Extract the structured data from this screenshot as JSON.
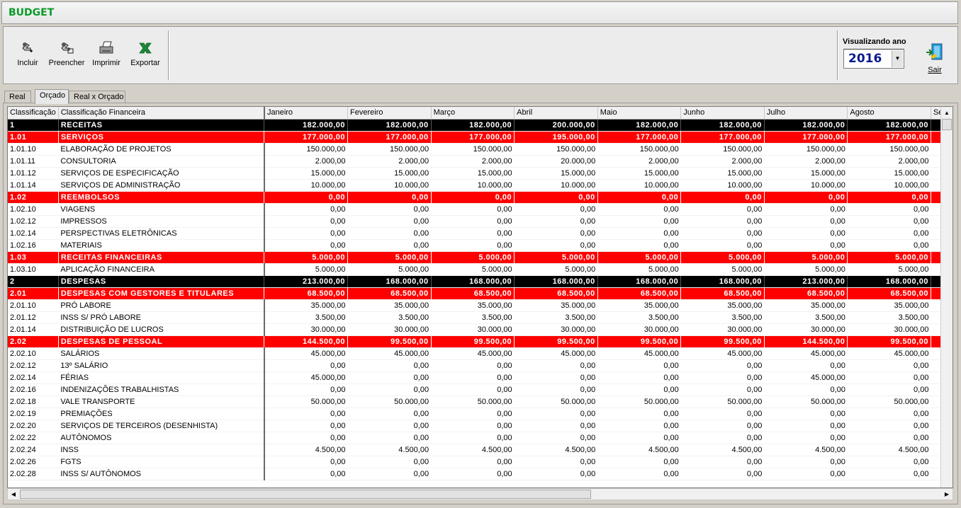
{
  "app": {
    "title": "BUDGET"
  },
  "toolbar": {
    "incluir": "Incluir",
    "preencher": "Preencher",
    "imprimir": "Imprimir",
    "exportar": "Exportar",
    "year_label": "Visualizando ano",
    "year_value": "2016",
    "exit_label": "Sair"
  },
  "tabs": [
    "Real",
    "Orçado",
    "Real x Orçado"
  ],
  "active_tab": "Orçado",
  "colors": {
    "section_black": "#000000",
    "section_red": "#ff0000",
    "title_green": "#0a9a2a",
    "year_blue": "#0a1a8c"
  },
  "grid": {
    "columns": [
      "Classificação",
      "Classificação Financeira",
      "Janeiro",
      "Fevereiro",
      "Março",
      "Abril",
      "Maio",
      "Junho",
      "Julho",
      "Agosto",
      "Se"
    ],
    "rows": [
      {
        "level": "black",
        "code": "1",
        "name": "RECEITAS",
        "values": [
          "182.000,00",
          "182.000,00",
          "182.000,00",
          "200.000,00",
          "182.000,00",
          "182.000,00",
          "182.000,00",
          "182.000,00"
        ]
      },
      {
        "level": "red",
        "code": "1.01",
        "name": "SERVIÇOS",
        "values": [
          "177.000,00",
          "177.000,00",
          "177.000,00",
          "195.000,00",
          "177.000,00",
          "177.000,00",
          "177.000,00",
          "177.000,00"
        ]
      },
      {
        "level": "normal",
        "code": "1.01.10",
        "name": "ELABORAÇÃO DE PROJETOS",
        "values": [
          "150.000,00",
          "150.000,00",
          "150.000,00",
          "150.000,00",
          "150.000,00",
          "150.000,00",
          "150.000,00",
          "150.000,00"
        ]
      },
      {
        "level": "normal",
        "code": "1.01.11",
        "name": "CONSULTORIA",
        "values": [
          "2.000,00",
          "2.000,00",
          "2.000,00",
          "20.000,00",
          "2.000,00",
          "2.000,00",
          "2.000,00",
          "2.000,00"
        ]
      },
      {
        "level": "normal",
        "code": "1.01.12",
        "name": "SERVIÇOS DE ESPECIFICAÇÃO",
        "values": [
          "15.000,00",
          "15.000,00",
          "15.000,00",
          "15.000,00",
          "15.000,00",
          "15.000,00",
          "15.000,00",
          "15.000,00"
        ]
      },
      {
        "level": "normal",
        "code": "1.01.14",
        "name": "SERVIÇOS DE ADMINISTRAÇÃO",
        "values": [
          "10.000,00",
          "10.000,00",
          "10.000,00",
          "10.000,00",
          "10.000,00",
          "10.000,00",
          "10.000,00",
          "10.000,00"
        ]
      },
      {
        "level": "red",
        "code": "1.02",
        "name": "REEMBOLSOS",
        "values": [
          "0,00",
          "0,00",
          "0,00",
          "0,00",
          "0,00",
          "0,00",
          "0,00",
          "0,00"
        ]
      },
      {
        "level": "normal",
        "code": "1.02.10",
        "name": "VIAGENS",
        "values": [
          "0,00",
          "0,00",
          "0,00",
          "0,00",
          "0,00",
          "0,00",
          "0,00",
          "0,00"
        ]
      },
      {
        "level": "normal",
        "code": "1.02.12",
        "name": "IMPRESSOS",
        "values": [
          "0,00",
          "0,00",
          "0,00",
          "0,00",
          "0,00",
          "0,00",
          "0,00",
          "0,00"
        ]
      },
      {
        "level": "normal",
        "code": "1.02.14",
        "name": "PERSPECTIVAS ELETRÔNICAS",
        "values": [
          "0,00",
          "0,00",
          "0,00",
          "0,00",
          "0,00",
          "0,00",
          "0,00",
          "0,00"
        ]
      },
      {
        "level": "normal",
        "code": "1.02.16",
        "name": "MATERIAIS",
        "values": [
          "0,00",
          "0,00",
          "0,00",
          "0,00",
          "0,00",
          "0,00",
          "0,00",
          "0,00"
        ]
      },
      {
        "level": "red",
        "code": "1.03",
        "name": "RECEITAS FINANCEIRAS",
        "values": [
          "5.000,00",
          "5.000,00",
          "5.000,00",
          "5.000,00",
          "5.000,00",
          "5.000,00",
          "5.000,00",
          "5.000,00"
        ]
      },
      {
        "level": "normal",
        "code": "1.03.10",
        "name": "APLICAÇÃO FINANCEIRA",
        "values": [
          "5.000,00",
          "5.000,00",
          "5.000,00",
          "5.000,00",
          "5.000,00",
          "5.000,00",
          "5.000,00",
          "5.000,00"
        ]
      },
      {
        "level": "black",
        "code": "2",
        "name": "DESPESAS",
        "values": [
          "213.000,00",
          "168.000,00",
          "168.000,00",
          "168.000,00",
          "168.000,00",
          "168.000,00",
          "213.000,00",
          "168.000,00"
        ]
      },
      {
        "level": "red",
        "code": "2.01",
        "name": "DESPESAS COM GESTORES E TITULARES",
        "values": [
          "68.500,00",
          "68.500,00",
          "68.500,00",
          "68.500,00",
          "68.500,00",
          "68.500,00",
          "68.500,00",
          "68.500,00"
        ]
      },
      {
        "level": "normal",
        "code": "2.01.10",
        "name": "PRÓ LABORE",
        "values": [
          "35.000,00",
          "35.000,00",
          "35.000,00",
          "35.000,00",
          "35.000,00",
          "35.000,00",
          "35.000,00",
          "35.000,00"
        ]
      },
      {
        "level": "normal",
        "code": "2.01.12",
        "name": "INSS S/ PRÓ LABORE",
        "values": [
          "3.500,00",
          "3.500,00",
          "3.500,00",
          "3.500,00",
          "3.500,00",
          "3.500,00",
          "3.500,00",
          "3.500,00"
        ]
      },
      {
        "level": "normal",
        "code": "2.01.14",
        "name": "DISTRIBUIÇÃO DE LUCROS",
        "values": [
          "30.000,00",
          "30.000,00",
          "30.000,00",
          "30.000,00",
          "30.000,00",
          "30.000,00",
          "30.000,00",
          "30.000,00"
        ]
      },
      {
        "level": "red",
        "code": "2.02",
        "name": "DESPESAS DE PESSOAL",
        "values": [
          "144.500,00",
          "99.500,00",
          "99.500,00",
          "99.500,00",
          "99.500,00",
          "99.500,00",
          "144.500,00",
          "99.500,00"
        ]
      },
      {
        "level": "normal",
        "code": "2.02.10",
        "name": "SALÁRIOS",
        "values": [
          "45.000,00",
          "45.000,00",
          "45.000,00",
          "45.000,00",
          "45.000,00",
          "45.000,00",
          "45.000,00",
          "45.000,00"
        ]
      },
      {
        "level": "normal",
        "code": "2.02.12",
        "name": "13º SALÁRIO",
        "values": [
          "0,00",
          "0,00",
          "0,00",
          "0,00",
          "0,00",
          "0,00",
          "0,00",
          "0,00"
        ]
      },
      {
        "level": "normal",
        "code": "2.02.14",
        "name": "FÉRIAS",
        "values": [
          "45.000,00",
          "0,00",
          "0,00",
          "0,00",
          "0,00",
          "0,00",
          "45.000,00",
          "0,00"
        ]
      },
      {
        "level": "normal",
        "code": "2.02.16",
        "name": "INDENIZAÇÕES TRABALHISTAS",
        "values": [
          "0,00",
          "0,00",
          "0,00",
          "0,00",
          "0,00",
          "0,00",
          "0,00",
          "0,00"
        ]
      },
      {
        "level": "normal",
        "code": "2.02.18",
        "name": "VALE TRANSPORTE",
        "values": [
          "50.000,00",
          "50.000,00",
          "50.000,00",
          "50.000,00",
          "50.000,00",
          "50.000,00",
          "50.000,00",
          "50.000,00"
        ]
      },
      {
        "level": "normal",
        "code": "2.02.19",
        "name": "PREMIAÇÕES",
        "values": [
          "0,00",
          "0,00",
          "0,00",
          "0,00",
          "0,00",
          "0,00",
          "0,00",
          "0,00"
        ]
      },
      {
        "level": "normal",
        "code": "2.02.20",
        "name": "SERVIÇOS DE TERCEIROS (DESENHISTA)",
        "values": [
          "0,00",
          "0,00",
          "0,00",
          "0,00",
          "0,00",
          "0,00",
          "0,00",
          "0,00"
        ]
      },
      {
        "level": "normal",
        "code": "2.02.22",
        "name": "AUTÔNOMOS",
        "values": [
          "0,00",
          "0,00",
          "0,00",
          "0,00",
          "0,00",
          "0,00",
          "0,00",
          "0,00"
        ]
      },
      {
        "level": "normal",
        "code": "2.02.24",
        "name": "INSS",
        "values": [
          "4.500,00",
          "4.500,00",
          "4.500,00",
          "4.500,00",
          "4.500,00",
          "4.500,00",
          "4.500,00",
          "4.500,00"
        ]
      },
      {
        "level": "normal",
        "code": "2.02.26",
        "name": "FGTS",
        "values": [
          "0,00",
          "0,00",
          "0,00",
          "0,00",
          "0,00",
          "0,00",
          "0,00",
          "0,00"
        ]
      },
      {
        "level": "normal",
        "code": "2.02.28",
        "name": "INSS S/ AUTÔNOMOS",
        "values": [
          "0,00",
          "0,00",
          "0,00",
          "0,00",
          "0,00",
          "0,00",
          "0,00",
          "0,00"
        ]
      }
    ]
  }
}
